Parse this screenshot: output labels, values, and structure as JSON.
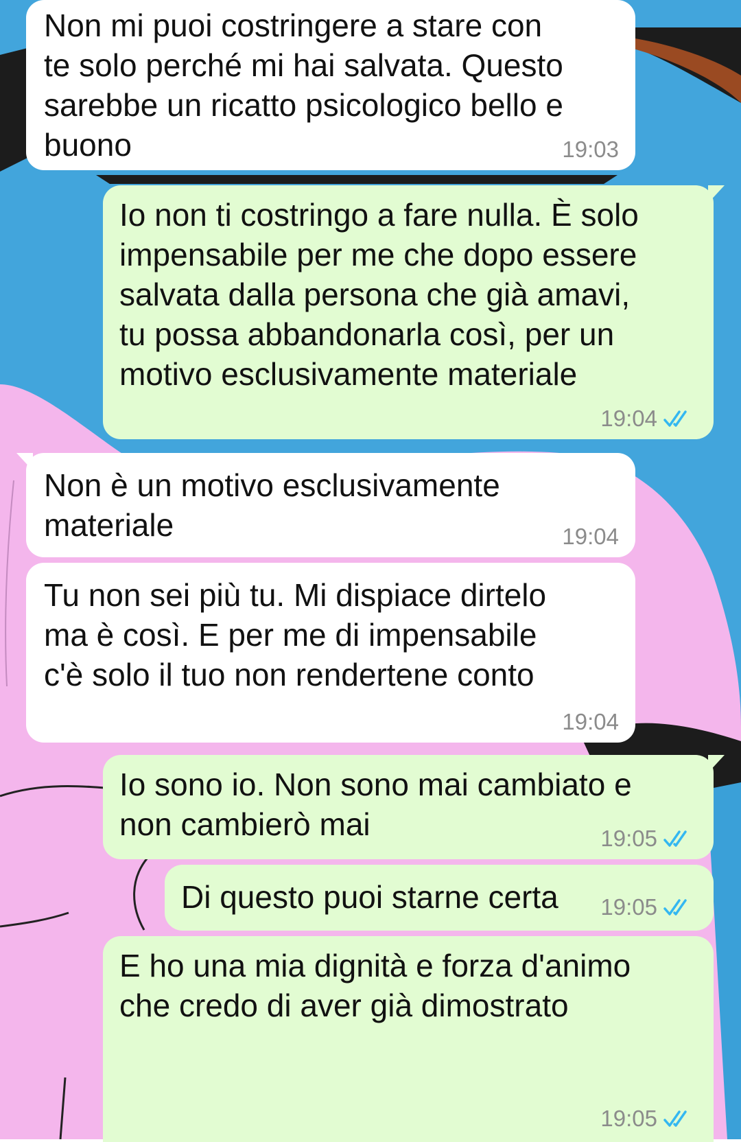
{
  "colors": {
    "wallpaper_blue": "#42a5dc",
    "wallpaper_pink": "#f4b6ec",
    "incoming_bubble": "#ffffff",
    "outgoing_bubble": "#e2fcd2",
    "timestamp": "#8b8b8b",
    "read_check": "#34b7f1"
  },
  "messages": [
    {
      "direction": "incoming",
      "text": "Non mi puoi costringere a stare con\nte solo perché mi hai salvata. Questo\nsarebbe un ricatto psicologico bello e\nbuono",
      "time": "19:03"
    },
    {
      "direction": "outgoing",
      "text": "Io non ti costringo a fare nulla. È solo\nimpensabile per me che dopo essere\nsalvata dalla persona che già amavi,\ntu possa abbandonarla così, per un\nmotivo esclusivamente materiale",
      "time": "19:04",
      "status_icon": "double-check-read-icon"
    },
    {
      "direction": "incoming",
      "text": "Non è un motivo esclusivamente\nmateriale",
      "time": "19:04"
    },
    {
      "direction": "incoming",
      "text": "Tu non sei più tu. Mi dispiace dirtelo\nma è così. E per me di impensabile\nc'è solo il tuo non rendertene conto",
      "time": "19:04"
    },
    {
      "direction": "outgoing",
      "text": "Io sono io. Non sono mai cambiato e\nnon cambierò mai",
      "time": "19:05",
      "status_icon": "double-check-read-icon"
    },
    {
      "direction": "outgoing",
      "text": "Di questo puoi starne certa",
      "time": "19:05",
      "status_icon": "double-check-read-icon"
    },
    {
      "direction": "outgoing",
      "text": "E ho una mia dignità e forza d'animo\nche credo di aver già dimostrato",
      "time": "19:05",
      "status_icon": "double-check-read-icon"
    }
  ]
}
